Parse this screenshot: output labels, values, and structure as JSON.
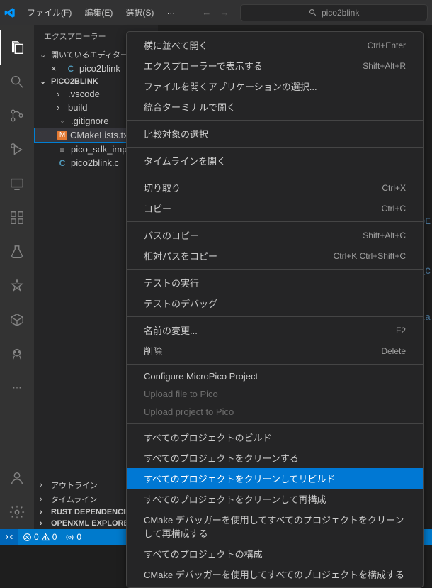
{
  "titlebar": {
    "menus": [
      "ファイル(F)",
      "編集(E)",
      "選択(S)",
      "…"
    ],
    "search_placeholder": "pico2blink"
  },
  "sidebar": {
    "title": "エクスプローラー",
    "open_editors": "開いているエディター",
    "open_files": [
      {
        "name": "pico2blink",
        "icon": "C"
      }
    ],
    "project": "PICO2BLINK",
    "tree": [
      {
        "name": ".vscode",
        "type": "folder"
      },
      {
        "name": "build",
        "type": "folder"
      },
      {
        "name": ".gitignore",
        "type": "file",
        "icon": "txt"
      },
      {
        "name": "CMakeLists.txt",
        "type": "file",
        "icon": "M",
        "selected": true
      },
      {
        "name": "pico_sdk_import",
        "type": "file",
        "icon": "≡"
      },
      {
        "name": "pico2blink.c",
        "type": "file",
        "icon": "C"
      }
    ],
    "collapsed_sections": [
      "アウトライン",
      "タイムライン",
      "RUST DEPENDENCIES",
      "OPENXML EXPLORER"
    ]
  },
  "context_menu": [
    {
      "label": "横に並べて開く",
      "shortcut": "Ctrl+Enter"
    },
    {
      "label": "エクスプローラーで表示する",
      "shortcut": "Shift+Alt+R"
    },
    {
      "label": "ファイルを開くアプリケーションの選択..."
    },
    {
      "label": "統合ターミナルで開く"
    },
    {
      "sep": true
    },
    {
      "label": "比較対象の選択"
    },
    {
      "sep": true
    },
    {
      "label": "タイムラインを開く"
    },
    {
      "sep": true
    },
    {
      "label": "切り取り",
      "shortcut": "Ctrl+X"
    },
    {
      "label": "コピー",
      "shortcut": "Ctrl+C"
    },
    {
      "sep": true
    },
    {
      "label": "パスのコピー",
      "shortcut": "Shift+Alt+C"
    },
    {
      "label": "相対パスをコピー",
      "shortcut": "Ctrl+K Ctrl+Shift+C"
    },
    {
      "sep": true
    },
    {
      "label": "テストの実行"
    },
    {
      "label": "テストのデバッグ"
    },
    {
      "sep": true
    },
    {
      "label": "名前の変更...",
      "shortcut": "F2"
    },
    {
      "label": "削除",
      "shortcut": "Delete"
    },
    {
      "sep": true
    },
    {
      "label": "Configure MicroPico Project"
    },
    {
      "label": "Upload file to Pico",
      "disabled": true
    },
    {
      "label": "Upload project to Pico",
      "disabled": true
    },
    {
      "sep": true
    },
    {
      "label": "すべてのプロジェクトのビルド"
    },
    {
      "label": "すべてのプロジェクトをクリーンする"
    },
    {
      "label": "すべてのプロジェクトをクリーンしてリビルド",
      "selected": true
    },
    {
      "label": "すべてのプロジェクトをクリーンして再構成"
    },
    {
      "label": "CMake デバッガーを使用してすべてのプロジェクトをクリーンして再構成する"
    },
    {
      "label": "すべてのプロジェクトの構成"
    },
    {
      "label": "CMake デバッガーを使用してすべてのプロジェクトを構成する"
    }
  ],
  "statusbar": {
    "errors": "0",
    "warnings": "0",
    "ports": "0"
  },
  "editor_hints": [
    "DE",
    "_C",
    "la"
  ]
}
